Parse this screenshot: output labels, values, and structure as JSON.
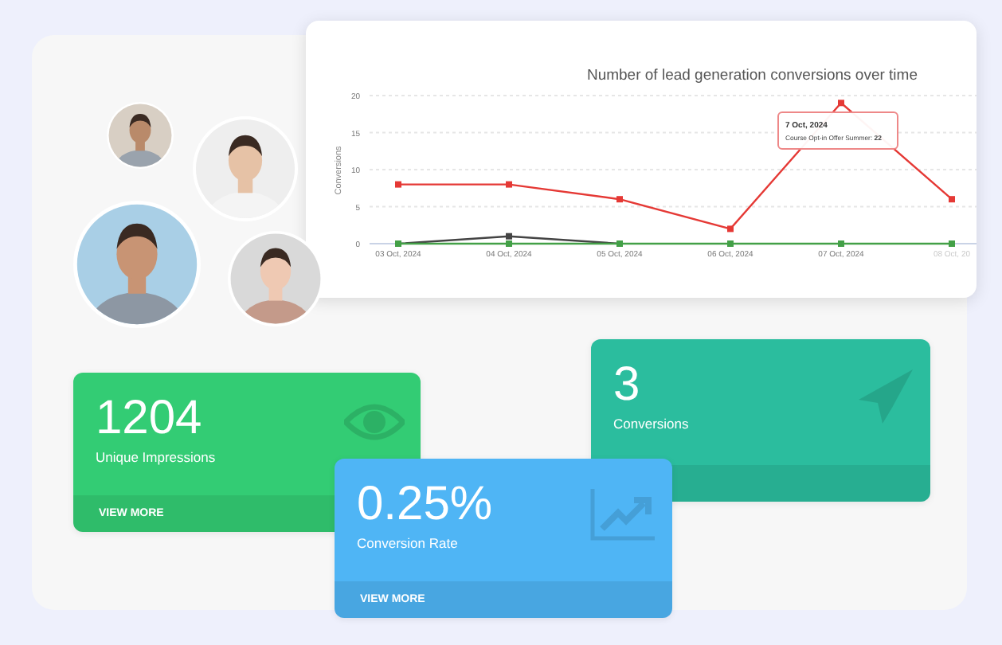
{
  "chart": {
    "chart_data": {
      "type": "line",
      "grid": true,
      "title": "Number of lead generation conversions over time",
      "ylabel": "Conversions",
      "categories": [
        "03 Oct, 2024",
        "04 Oct, 2024",
        "05 Oct, 2024",
        "06 Oct, 2024",
        "07 Oct, 2024",
        "08 Oct, 20"
      ],
      "ylim": [
        0,
        20
      ],
      "yticks": [
        0,
        5,
        10,
        15,
        20
      ],
      "series": [
        {
          "color": "#e53935",
          "marker": "square",
          "values": [
            8,
            8,
            6,
            2,
            19,
            6
          ]
        },
        {
          "color": "#444444",
          "marker": "square",
          "values": [
            0,
            1,
            0,
            null,
            null,
            null
          ]
        },
        {
          "color": "#43a047",
          "marker": "square",
          "values": [
            0,
            0,
            0,
            0,
            0,
            0
          ]
        }
      ]
    },
    "tooltip": {
      "title": "7 Oct, 2024",
      "text": "Course Opt-in Offer Summer: **22**"
    }
  },
  "stats": [
    {
      "kind": "eye",
      "value": "1204",
      "label": "Unique Impressions",
      "footer": "VIEW MORE",
      "color": "#33cc74"
    },
    {
      "kind": "plane",
      "value": "3",
      "label": "Conversions",
      "color": "#2bbd9e"
    },
    {
      "kind": "trend",
      "value": "0.25%",
      "label": "Conversion Rate",
      "footer": "VIEW MORE",
      "color": "#4fb5f5"
    }
  ]
}
